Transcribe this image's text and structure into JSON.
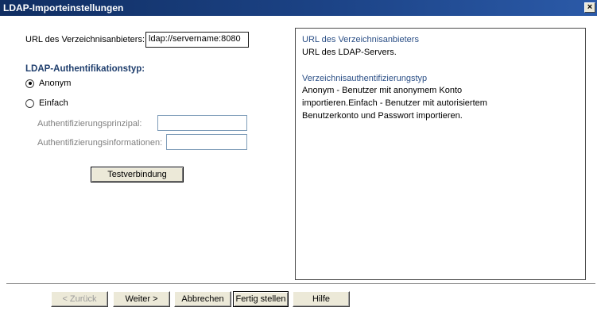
{
  "window": {
    "title": "LDAP-Importeinstellungen",
    "close_glyph": "×"
  },
  "form": {
    "url_label": "URL des Verzeichnisanbieters:",
    "url_value": "ldap://servername:8080",
    "auth_type_heading": "LDAP-Authentifikationstyp:",
    "radio_anonymous": "Anonym",
    "radio_simple": "Einfach",
    "selected_auth": "Anonym",
    "principal_label": "Authentifizierungsprinzipal:",
    "principal_value": "",
    "credentials_label": "Authentifizierungsinformationen:",
    "credentials_value": "",
    "test_button": "Testverbindung"
  },
  "help": {
    "heading1": "URL des Verzeichnisanbieters",
    "text1": "URL des LDAP-Servers.",
    "heading2": "Verzeichnisauthentifizierungstyp",
    "text2_line1": "Anonym - Benutzer mit anonymem Konto",
    "text2_line2": "importieren.Einfach - Benutzer mit autorisiertem",
    "text2_line3": "Benutzerkonto und Passwort importieren."
  },
  "footer": {
    "back": "< Zurück",
    "next": "Weiter >",
    "cancel": "Abbrechen",
    "finish": "Fertig stellen",
    "help": "Hilfe"
  }
}
